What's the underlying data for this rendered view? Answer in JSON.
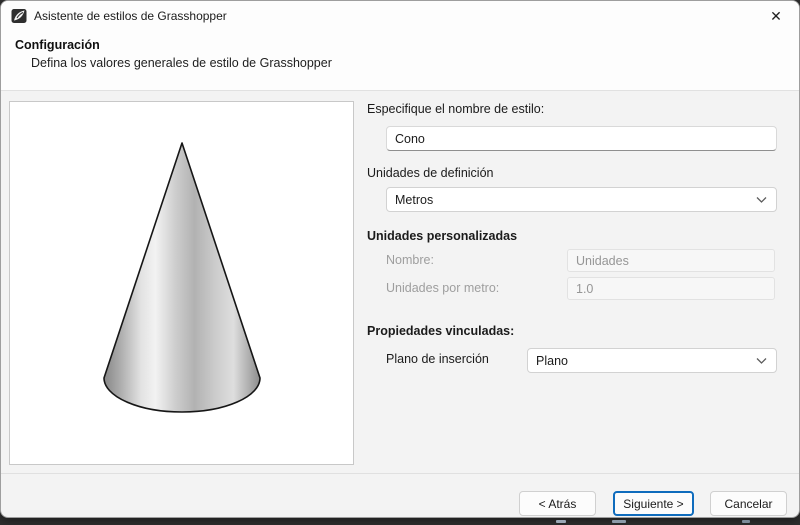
{
  "window": {
    "title": "Asistente de estilos de Grasshopper",
    "close_glyph": "✕"
  },
  "header": {
    "title": "Configuración",
    "subtitle": "Defina los valores generales de estilo de Grasshopper"
  },
  "form": {
    "name": {
      "label": "Especifique el nombre de estilo:",
      "value": "Cono"
    },
    "definition_units": {
      "label": "Unidades de definición",
      "value": "Metros"
    },
    "custom_units": {
      "label": "Unidades personalizadas",
      "name": {
        "label": "Nombre:",
        "value": "Unidades"
      },
      "per_meter": {
        "label": "Unidades por metro:",
        "value": "1.0"
      }
    },
    "linked_properties": {
      "label": "Propiedades vinculadas:",
      "insertion_plane": {
        "label": "Plano de inserción",
        "value": "Plano"
      }
    }
  },
  "footer": {
    "back": "< Atrás",
    "next": "Siguiente >",
    "cancel": "Cancelar"
  },
  "icons": {
    "app": "grasshopper-logo-icon",
    "dropdown": "chevron-down-icon",
    "preview": "cone-preview-image"
  },
  "colors": {
    "accent": "#0f6cbd",
    "titlebar_bg": "#fdfdfd",
    "content_bg": "#f3f3f3",
    "preview_bg": "#ffffff",
    "disabled_text": "#9e9e9e"
  }
}
